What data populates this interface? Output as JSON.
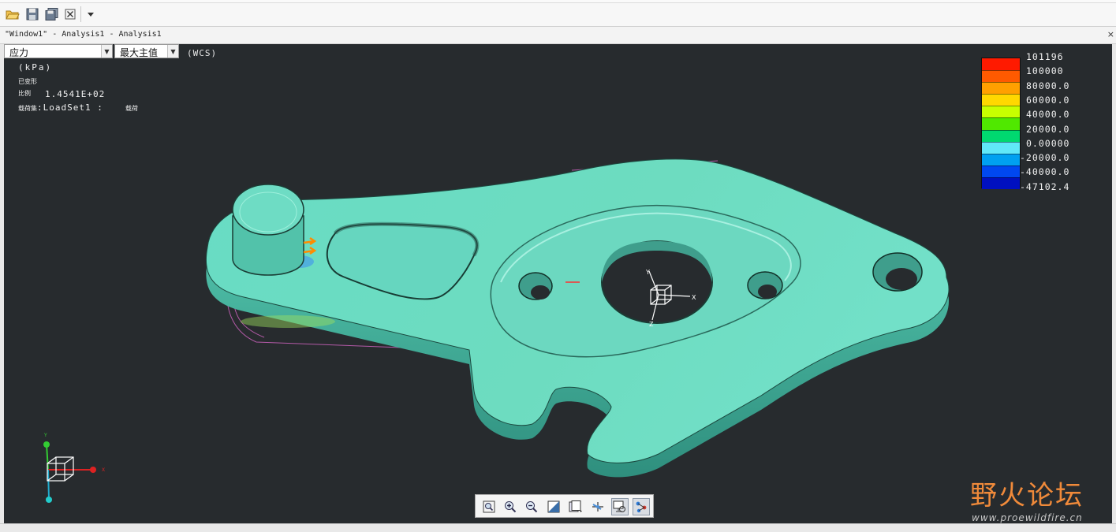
{
  "window": {
    "title": "\"Window1\" - Analysis1 - Analysis1",
    "close": "×"
  },
  "toolbar": {
    "icons": [
      "open-folder-icon",
      "save-icon",
      "save-copy-icon",
      "close-window-icon",
      "dropdown-arrow-icon"
    ]
  },
  "viewport": {
    "quantity_select": {
      "value": "应力"
    },
    "component_select": {
      "value": "最大主值"
    },
    "coord_system": "(WCS)",
    "info": {
      "units": "(kPa)",
      "deformed": "已变形",
      "scale_label": "比例",
      "scale_value": "1.4541E+02",
      "loadset_label": "载荷集",
      "loadset_value": ":LoadSet1 :",
      "loadset_status": "载荷"
    }
  },
  "legend": {
    "labels": [
      "101196",
      "100000",
      "80000.0",
      "60000.0",
      "40000.0",
      "20000.0",
      "0.00000",
      "-20000.0",
      "-40000.0",
      "-47102.4"
    ],
    "colors": [
      "#ff1a00",
      "#ff5a00",
      "#ffa000",
      "#ffd800",
      "#c8ff00",
      "#50e800",
      "#00d870",
      "#60e8f8",
      "#00a0f0",
      "#0048f0",
      "#0010c0"
    ]
  },
  "triad": {
    "x": "X",
    "y": "Y",
    "z": "Z"
  },
  "view_toolbar": {
    "icons": [
      "zoom-fit-icon",
      "zoom-in-icon",
      "zoom-out-icon",
      "shading-icon",
      "saved-views-icon",
      "spin-center-icon",
      "display-style-icon",
      "datum-display-icon"
    ]
  },
  "watermark": {
    "text": "野火论坛",
    "url": "www.proewildfire.cn"
  }
}
